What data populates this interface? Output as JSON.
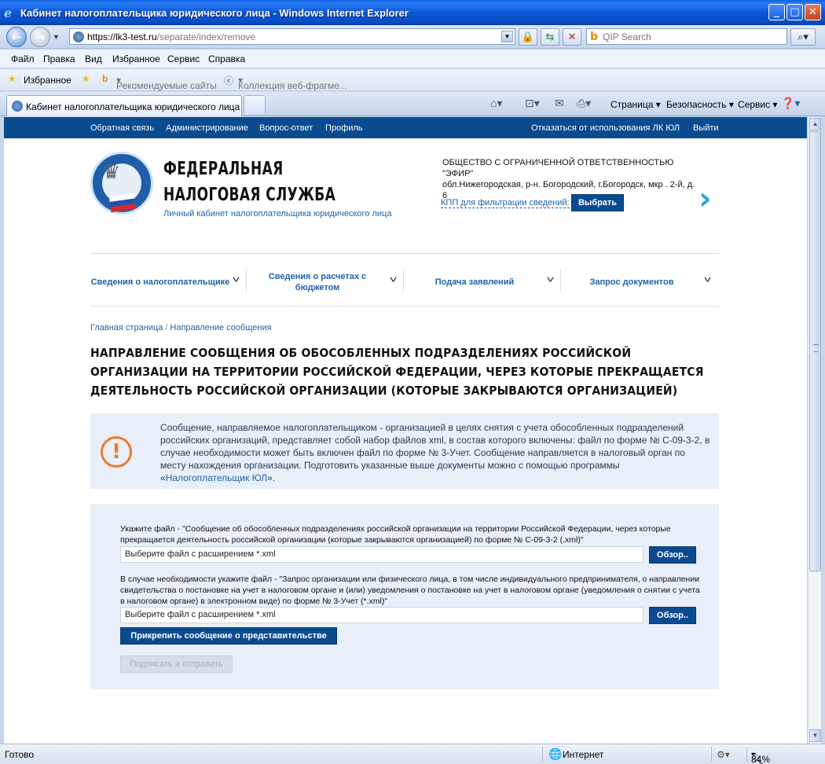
{
  "window": {
    "title": "Кабинет налогоплательщика юридического лица - Windows Internet Explorer",
    "minimize": "_",
    "maximize": "□",
    "close": "✕"
  },
  "address": {
    "url_host": "https://lk3-test.ru",
    "url_path": "/separate/index/remove",
    "search_placeholder": "QIP Search"
  },
  "menu": [
    "Файл",
    "Правка",
    "Вид",
    "Избранное",
    "Сервис",
    "Справка"
  ],
  "favbar": {
    "favorites": "Избранное",
    "suggested": "Рекомендуемые сайты",
    "gallery": "Коллекция веб-фрагме..."
  },
  "tab": {
    "title": "Кабинет налогоплательщика юридического лица"
  },
  "commandbar": {
    "page": "Страница",
    "safety": "Безопасность",
    "tools": "Сервис"
  },
  "topnav": {
    "feedback": "Обратная связь",
    "admin": "Администрирование",
    "faq": "Вопрос-ответ",
    "profile": "Профиль",
    "refuse": "Отказаться от использования ЛК ЮЛ",
    "logout": "Выйти"
  },
  "brand": {
    "line1": "ФЕДЕРАЛЬНАЯ",
    "line2": "НАЛОГОВАЯ СЛУЖБА",
    "subtitle": "Личный кабинет налогоплательщика юридического лица"
  },
  "org": {
    "name": "ОБЩЕСТВО С ОГРАНИЧЕННОЙ ОТВЕТСТВЕННОСТЬЮ \"ЭФИР\"",
    "address": "обл.Нижегородская, р-н. Богородский, г.Богородск, мкр . 2-й, д. 6",
    "kpp_label": "КПП для фильтрации сведений:",
    "choose": "Выбрать"
  },
  "mainnav": [
    {
      "label": "Сведения о налогоплательщике"
    },
    {
      "label": "Сведения о расчетах с бюджетом"
    },
    {
      "label": "Подача заявлений"
    },
    {
      "label": "Запрос документов"
    }
  ],
  "breadcrumb": {
    "home": "Главная страница",
    "sep": "/",
    "current": "Направление сообщения"
  },
  "page_title": "НАПРАВЛЕНИЕ СООБЩЕНИЯ ОБ ОБОСОБЛЕННЫХ ПОДРАЗДЕЛЕНИЯХ РОССИЙСКОЙ ОРГАНИЗАЦИИ НА ТЕРРИТОРИИ РОССИЙСКОЙ ФЕДЕРАЦИИ, ЧЕРЕЗ КОТОРЫЕ ПРЕКРАЩАЕТСЯ ДЕЯТЕЛЬНОСТЬ РОССИЙСКОЙ ОРГАНИЗАЦИИ (КОТОРЫЕ ЗАКРЫВАЮТСЯ ОРГАНИЗАЦИЕЙ)",
  "notice": {
    "text_before": "Сообщение, направляемое налогоплательщиком - организацией в целях снятия с учета обособленных подразделений российских организаций, представляет собой набор файлов xml, в состав которого включены: файл по форме № С-09-3-2, в случае необходимости может быть включен файл по форме № 3-Учет. Сообщение направляется в налоговый орган по месту нахождения организации. Подготовить указанные выше документы можно с помощью программы «",
    "link": "Налогоплательщик ЮЛ",
    "text_after": "»."
  },
  "form": {
    "file1_label": "Укажите файл - \"Сообщение об обособленных подразделениях российской организации на территории Российской Федерации, через которые прекращается деятельность российской организации (которые закрываются организацией) по форме № С-09-3-2 (.xml)\"",
    "file1_placeholder": "Выберите файл с расширением *.xml",
    "browse": "Обзор..",
    "file2_label": "В случае необходимости укажите файл - \"Запрос организации или физического лица, в том числе индивидуального предпринимателя, о направлении свидетельства о постановке на учет в налоговом органе и (или) уведомления о постановке на учет в налоговом органе (уведомления о снятии с учета в налоговом органе) в электронном виде) по форме № 3-Учет (*.xml)\"",
    "file2_placeholder": "Выберите файл с расширением *.xml",
    "attach": "Прикрепить сообщение о представительстве",
    "submit": "Подписать и отправить"
  },
  "status": {
    "ready": "Готово",
    "zone": "Интернет",
    "zoom": "84%"
  },
  "colors": {
    "primary": "#0a4b8f",
    "link": "#1d63a8",
    "panel": "#e8eff8",
    "warning": "#ee7a2c"
  }
}
